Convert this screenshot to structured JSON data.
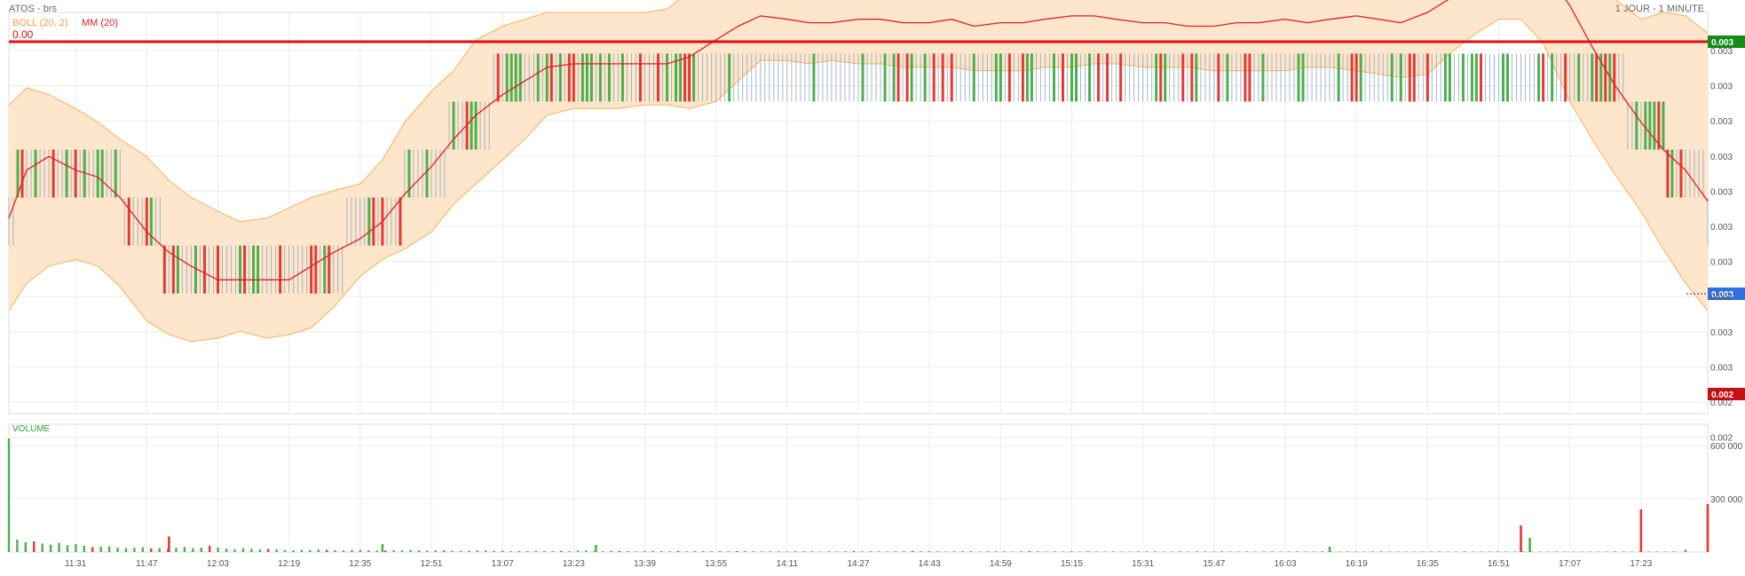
{
  "header": {
    "instrument": "ATOS - brs",
    "period": "1 JOUR - 1 MINUTE",
    "boll_label": "BOLL (20, 2)",
    "mm_label": "MM (20)",
    "mm_value": "0.00"
  },
  "colors": {
    "band_fill": "#fde6cc",
    "band_line": "#f5b25a",
    "mm_line": "#e02020",
    "up": "#4caf50",
    "down": "#e53935",
    "neutral": "#8ea6c0",
    "ref_line": "#dd1111",
    "ref_badge": "#188a18",
    "last_badge": "#2f6fe0",
    "low_badge": "#c41010",
    "volume_title": "#2ea02e"
  },
  "chart_data": [
    {
      "type": "line",
      "title": "",
      "subtitle": "ATOS - brs",
      "xlabel": "",
      "ylabel": "",
      "x_tick_labels": [
        "11:31",
        "11:47",
        "12:03",
        "12:19",
        "12:35",
        "12:51",
        "13:07",
        "13:23",
        "13:39",
        "13:55",
        "14:11",
        "14:27",
        "14:43",
        "14:59",
        "15:15",
        "15:31",
        "15:47",
        "16:03",
        "16:19",
        "16:35",
        "16:51",
        "17:07",
        "17:23"
      ],
      "y_tick_labels": [
        "0.003",
        "0.003",
        "0.003",
        "0.003",
        "0.003",
        "0.003",
        "0.003",
        "0.003",
        "0.003",
        "0.003",
        "0.002",
        "0.002"
      ],
      "ylim": [
        0.00225,
        0.00342
      ],
      "reference_line": {
        "value": "0.003",
        "label": "0.003"
      },
      "last_price": {
        "label": "0.003"
      },
      "low_marker": {
        "label": "0.002"
      },
      "price_levels": [
        0.0033,
        0.00316,
        0.00302,
        0.00288,
        0.00274,
        0.0026
      ],
      "series": [
        {
          "name": "MM (20)",
          "x": [
            "11:16",
            "11:20",
            "11:25",
            "11:31",
            "11:36",
            "11:41",
            "11:47",
            "11:52",
            "11:57",
            "12:03",
            "12:08",
            "12:14",
            "12:19",
            "12:24",
            "12:29",
            "12:35",
            "12:40",
            "12:45",
            "12:51",
            "12:56",
            "13:01",
            "13:07",
            "13:12",
            "13:17",
            "13:23",
            "13:28",
            "13:33",
            "13:39",
            "13:44",
            "13:49",
            "13:55",
            "14:00",
            "14:05",
            "14:11",
            "14:16",
            "14:21",
            "14:27",
            "14:32",
            "14:37",
            "14:43",
            "14:48",
            "14:53",
            "14:59",
            "15:04",
            "15:09",
            "15:15",
            "15:20",
            "15:25",
            "15:31",
            "15:36",
            "15:41",
            "15:47",
            "15:52",
            "15:57",
            "16:03",
            "16:08",
            "16:13",
            "16:19",
            "16:24",
            "16:29",
            "16:35",
            "16:40",
            "16:45",
            "16:51",
            "16:56",
            "17:01",
            "17:07",
            "17:12",
            "17:17",
            "17:23",
            "17:28",
            "17:33",
            "17:38"
          ],
          "values": [
            0.00282,
            0.00296,
            0.003,
            0.00296,
            0.00294,
            0.00288,
            0.00278,
            0.00272,
            0.00268,
            0.00264,
            0.00264,
            0.00264,
            0.00264,
            0.00268,
            0.00272,
            0.00276,
            0.00281,
            0.00289,
            0.00297,
            0.00305,
            0.00312,
            0.00318,
            0.00322,
            0.00326,
            0.00327,
            0.00327,
            0.00327,
            0.00327,
            0.00327,
            0.00329,
            0.00334,
            0.00338,
            0.00341,
            0.0034,
            0.00339,
            0.00339,
            0.0034,
            0.0034,
            0.00339,
            0.00339,
            0.0034,
            0.00338,
            0.00339,
            0.00339,
            0.0034,
            0.00341,
            0.00341,
            0.0034,
            0.00339,
            0.00339,
            0.00338,
            0.00338,
            0.00339,
            0.00339,
            0.0034,
            0.00339,
            0.0034,
            0.00341,
            0.0034,
            0.00339,
            0.00342,
            0.00346,
            0.0035,
            0.00355,
            0.00358,
            0.00355,
            0.00344,
            0.00332,
            0.00321,
            0.0031,
            0.00302,
            0.00296,
            0.00287
          ]
        },
        {
          "name": "BOLL (20, 2) upper",
          "x": [
            "11:16",
            "11:20",
            "11:25",
            "11:31",
            "11:36",
            "11:41",
            "11:47",
            "11:52",
            "11:57",
            "12:03",
            "12:08",
            "12:14",
            "12:19",
            "12:24",
            "12:29",
            "12:35",
            "12:40",
            "12:45",
            "12:51",
            "12:56",
            "13:01",
            "13:07",
            "13:12",
            "13:17",
            "13:23",
            "13:28",
            "13:33",
            "13:39",
            "13:44",
            "13:49",
            "13:55",
            "14:00",
            "14:05",
            "14:11",
            "14:16",
            "14:21",
            "14:27",
            "14:32",
            "14:37",
            "14:43",
            "14:48",
            "14:53",
            "14:59",
            "15:04",
            "15:09",
            "15:15",
            "15:20",
            "15:25",
            "15:31",
            "15:36",
            "15:41",
            "15:47",
            "15:52",
            "15:57",
            "16:03",
            "16:08",
            "16:13",
            "16:19",
            "16:24",
            "16:29",
            "16:35",
            "16:40",
            "16:45",
            "16:51",
            "16:56",
            "17:01",
            "17:07",
            "17:12",
            "17:17",
            "17:23",
            "17:28",
            "17:33",
            "17:38"
          ],
          "values": [
            0.00315,
            0.0032,
            0.00318,
            0.00314,
            0.0031,
            0.00305,
            0.003,
            0.00293,
            0.00288,
            0.00284,
            0.00281,
            0.00282,
            0.00285,
            0.00288,
            0.0029,
            0.00292,
            0.00299,
            0.0031,
            0.00319,
            0.00325,
            0.00334,
            0.00338,
            0.0034,
            0.00342,
            0.00342,
            0.00342,
            0.00342,
            0.00342,
            0.00343,
            0.00348,
            0.00353,
            0.00356,
            0.00355,
            0.00353,
            0.00352,
            0.00353,
            0.00354,
            0.00355,
            0.00355,
            0.00355,
            0.00354,
            0.00354,
            0.00354,
            0.00355,
            0.00355,
            0.00355,
            0.00355,
            0.00354,
            0.00354,
            0.00354,
            0.00353,
            0.00353,
            0.00354,
            0.00354,
            0.00354,
            0.00354,
            0.00355,
            0.00356,
            0.00358,
            0.00362,
            0.00366,
            0.0037,
            0.00373,
            0.00374,
            0.00375,
            0.00372,
            0.00365,
            0.00355,
            0.00346,
            0.0034,
            0.00342,
            0.00341,
            0.00336
          ]
        },
        {
          "name": "BOLL (20, 2) lower",
          "x": [
            "11:16",
            "11:20",
            "11:25",
            "11:31",
            "11:36",
            "11:41",
            "11:47",
            "11:52",
            "11:57",
            "12:03",
            "12:08",
            "12:14",
            "12:19",
            "12:24",
            "12:29",
            "12:35",
            "12:40",
            "12:45",
            "12:51",
            "12:56",
            "13:01",
            "13:07",
            "13:12",
            "13:17",
            "13:23",
            "13:28",
            "13:33",
            "13:39",
            "13:44",
            "13:49",
            "13:55",
            "14:00",
            "14:05",
            "14:11",
            "14:16",
            "14:21",
            "14:27",
            "14:32",
            "14:37",
            "14:43",
            "14:48",
            "14:53",
            "14:59",
            "15:04",
            "15:09",
            "15:15",
            "15:20",
            "15:25",
            "15:31",
            "15:36",
            "15:41",
            "15:47",
            "15:52",
            "15:57",
            "16:03",
            "16:08",
            "16:13",
            "16:19",
            "16:24",
            "16:29",
            "16:35",
            "16:40",
            "16:45",
            "16:51",
            "16:56",
            "17:01",
            "17:07",
            "17:12",
            "17:17",
            "17:23",
            "17:28",
            "17:33",
            "17:38"
          ],
          "values": [
            0.00255,
            0.00263,
            0.00268,
            0.0027,
            0.00268,
            0.00262,
            0.00252,
            0.00248,
            0.00246,
            0.00247,
            0.00249,
            0.00247,
            0.00248,
            0.0025,
            0.00256,
            0.00265,
            0.0027,
            0.00273,
            0.00278,
            0.00286,
            0.00292,
            0.00299,
            0.00305,
            0.00312,
            0.00314,
            0.00314,
            0.00314,
            0.00315,
            0.00315,
            0.00314,
            0.00316,
            0.00322,
            0.00328,
            0.00328,
            0.00327,
            0.00328,
            0.00327,
            0.00327,
            0.00326,
            0.00326,
            0.00326,
            0.00325,
            0.00325,
            0.00325,
            0.00326,
            0.00326,
            0.00327,
            0.00327,
            0.00326,
            0.00326,
            0.00326,
            0.00325,
            0.00325,
            0.00325,
            0.00325,
            0.00326,
            0.00326,
            0.00325,
            0.00324,
            0.00323,
            0.00324,
            0.0033,
            0.00335,
            0.0034,
            0.0034,
            0.00333,
            0.00316,
            0.00305,
            0.00295,
            0.00284,
            0.00273,
            0.00263,
            0.00255
          ]
        }
      ]
    },
    {
      "type": "bar",
      "title": "VOLUME",
      "xlabel": "",
      "ylabel": "",
      "y_tick_labels": [
        "600 000",
        "300 000"
      ],
      "ylim": [
        0,
        720000
      ],
      "x_span": [
        "11:16",
        "17:38"
      ],
      "values": [
        640000,
        70000,
        55000,
        60000,
        48000,
        42000,
        52000,
        38000,
        45000,
        35000,
        28000,
        30000,
        32000,
        25000,
        22000,
        24000,
        27000,
        20000,
        22000,
        18000,
        24000,
        28000,
        22000,
        25000,
        35000,
        25000,
        20000,
        16000,
        22000,
        18000,
        14000,
        18000,
        15000,
        12000,
        10000,
        12000,
        11000,
        14000,
        12000,
        10000,
        9000,
        11000,
        12000,
        10000,
        9000,
        8000,
        10000,
        9000,
        11000,
        10000,
        8000,
        9000,
        8000,
        7000,
        6000,
        7000,
        8000,
        9000,
        7000,
        6000,
        5000,
        6000,
        5000,
        7000,
        6000,
        5000,
        6000,
        5000,
        8000,
        9000,
        6000,
        5000,
        7000,
        6000,
        5000,
        4000,
        5000,
        6000,
        5000,
        4000,
        5000,
        4000,
        6000,
        5000,
        4000,
        5000,
        4000,
        5000,
        6000,
        5000,
        4000,
        5000,
        4000,
        3000,
        4000,
        5000,
        4000,
        3000,
        4000,
        3000,
        5000,
        6000,
        4000,
        5000,
        4000,
        3000,
        4000,
        5000,
        6000,
        4000,
        5000,
        4000,
        3000,
        4000,
        5000,
        4000,
        3000,
        4000,
        5000,
        4000,
        3000,
        4000,
        5000,
        4000,
        3000,
        4000,
        3000,
        4000,
        3000,
        4000,
        3000,
        3000,
        4000,
        3000,
        3000,
        4000,
        3000,
        4000,
        3000,
        3000,
        4000,
        3000,
        4000,
        3000,
        3000,
        4000,
        3000,
        3000,
        4000,
        3000,
        3000,
        4000,
        3000,
        3000,
        4000,
        3000,
        3000,
        4000,
        3000,
        3000,
        4000,
        3000,
        3000,
        4000,
        3000,
        3000,
        3000,
        3000,
        3000,
        3000,
        3000,
        3000,
        3000,
        3000,
        4000,
        3000,
        3000,
        3000,
        3000,
        3000,
        3000,
        4000,
        3000,
        3000,
        3000,
        3000,
        3000,
        3000,
        3000,
        3000,
        3000,
        3000,
        3000,
        3000,
        3000,
        3000,
        3000,
        3000,
        3000,
        3000
      ],
      "spikes": [
        {
          "x": "11:52",
          "value": 88000
        },
        {
          "x": "12:40",
          "value": 45000
        },
        {
          "x": "13:28",
          "value": 40000
        },
        {
          "x": "16:13",
          "value": 30000
        },
        {
          "x": "16:56",
          "value": 150000
        },
        {
          "x": "16:58",
          "value": 80000
        },
        {
          "x": "17:23",
          "value": 240000
        },
        {
          "x": "17:33",
          "value": 12000
        },
        {
          "x": "17:38",
          "value": 270000
        }
      ]
    }
  ]
}
